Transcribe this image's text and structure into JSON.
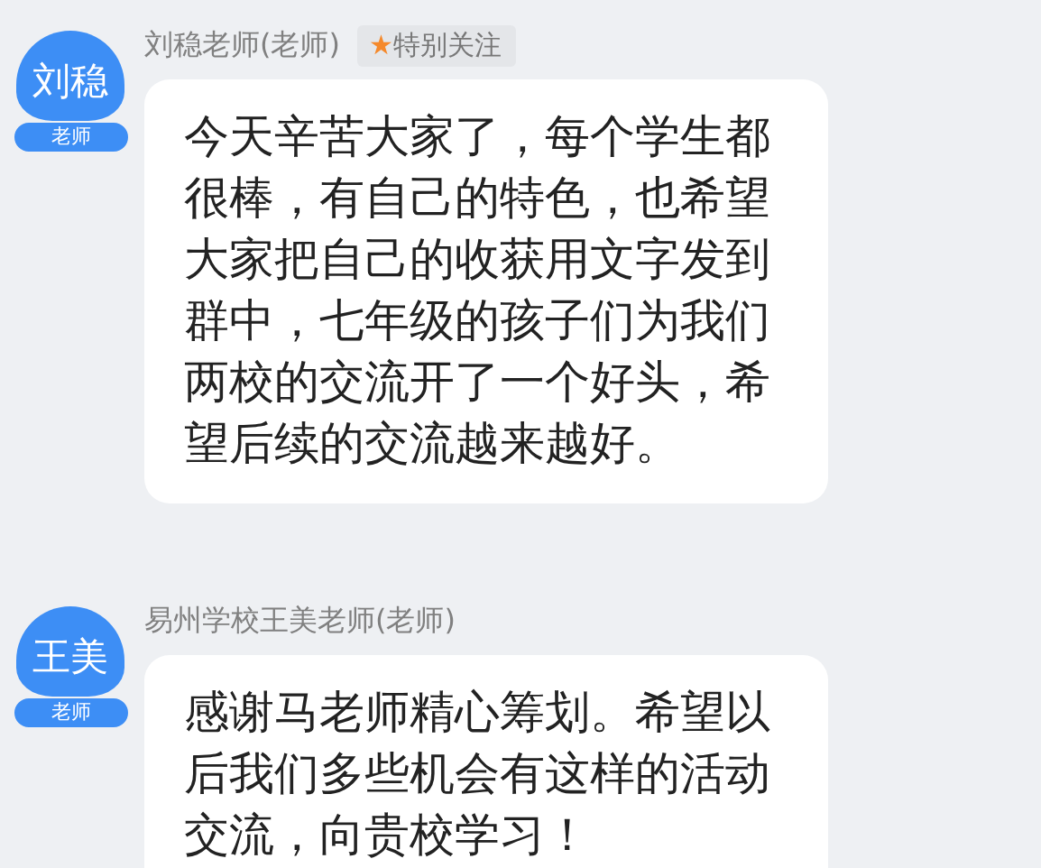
{
  "messages": [
    {
      "avatar": "刘稳",
      "role": "老师",
      "sender": "刘稳老师(老师)",
      "tag": {
        "star": "★",
        "label": "特别关注"
      },
      "text": "今天辛苦大家了，每个学生都很棒，有自己的特色，也希望大家把自己的收获用文字发到群中，七年级的孩子们为我们两校的交流开了一个好头，希望后续的交流越来越好。"
    },
    {
      "avatar": "王美",
      "role": "老师",
      "sender": "易州学校王美老师(老师)",
      "text": "感谢马老师精心筹划。希望以后我们多些机会有这样的活动交流，向贵校学习！"
    }
  ]
}
